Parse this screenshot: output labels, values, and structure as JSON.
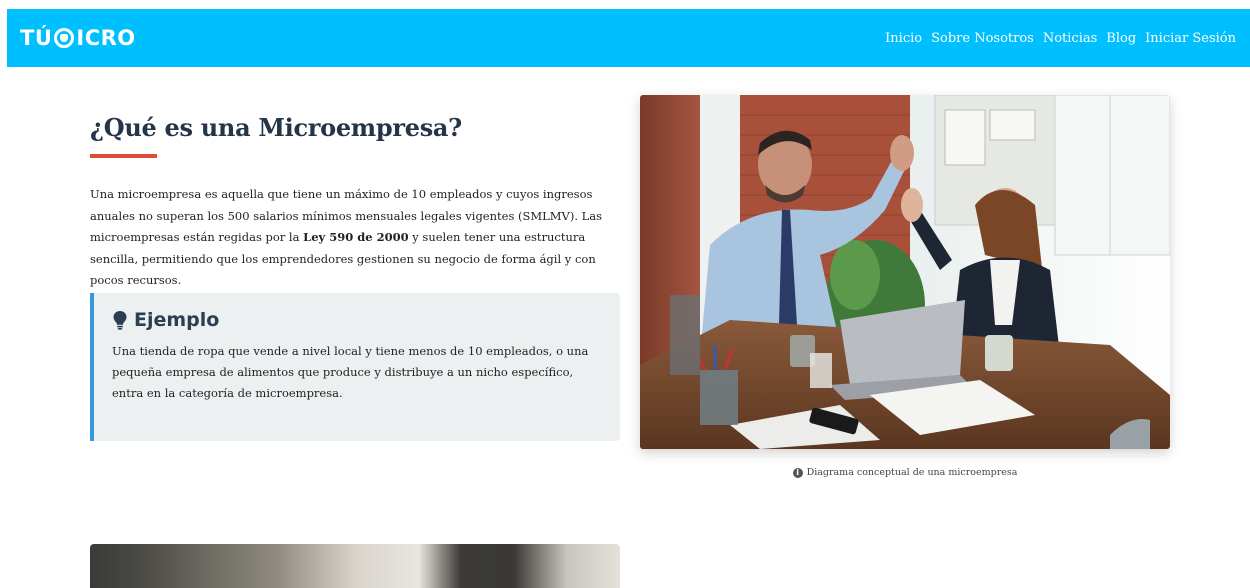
{
  "nav": {
    "logo_left": "TÚ",
    "logo_right": "ICRO",
    "links": [
      "Inicio",
      "Sobre Nosotros",
      "Noticias",
      "Blog",
      "Iniciar Sesión"
    ]
  },
  "hero": {
    "title": "¿Qué es una Microempresa?",
    "intro_1": "Una microempresa es aquella que tiene un máximo de 10 empleados y cuyos ingresos anuales no superan los 500 salarios mínimos mensuales legales vigentes (SMLMV). Las microempresas están regidas por la ",
    "intro_bold": "Ley 590 de 2000",
    "intro_2": " y suelen tener una estructura sencilla, permitiendo que los emprendedores gestionen su negocio de forma ágil y con pocos recursos.",
    "example_title": "Ejemplo",
    "example_text": "Una tienda de ropa que vende a nivel local y tiene menos de 10 empleados, o una pequeña empresa de alimentos que produce y distribuye a un nicho específico, entra en la categoría de microempresa.",
    "caption": "Diagrama conceptual de una microempresa"
  },
  "colors": {
    "navbar": "#00bfff",
    "title": "#233547",
    "accent_bar": "#e04b3a",
    "callout_border": "#3498db",
    "callout_bg": "#ecf0f1"
  }
}
